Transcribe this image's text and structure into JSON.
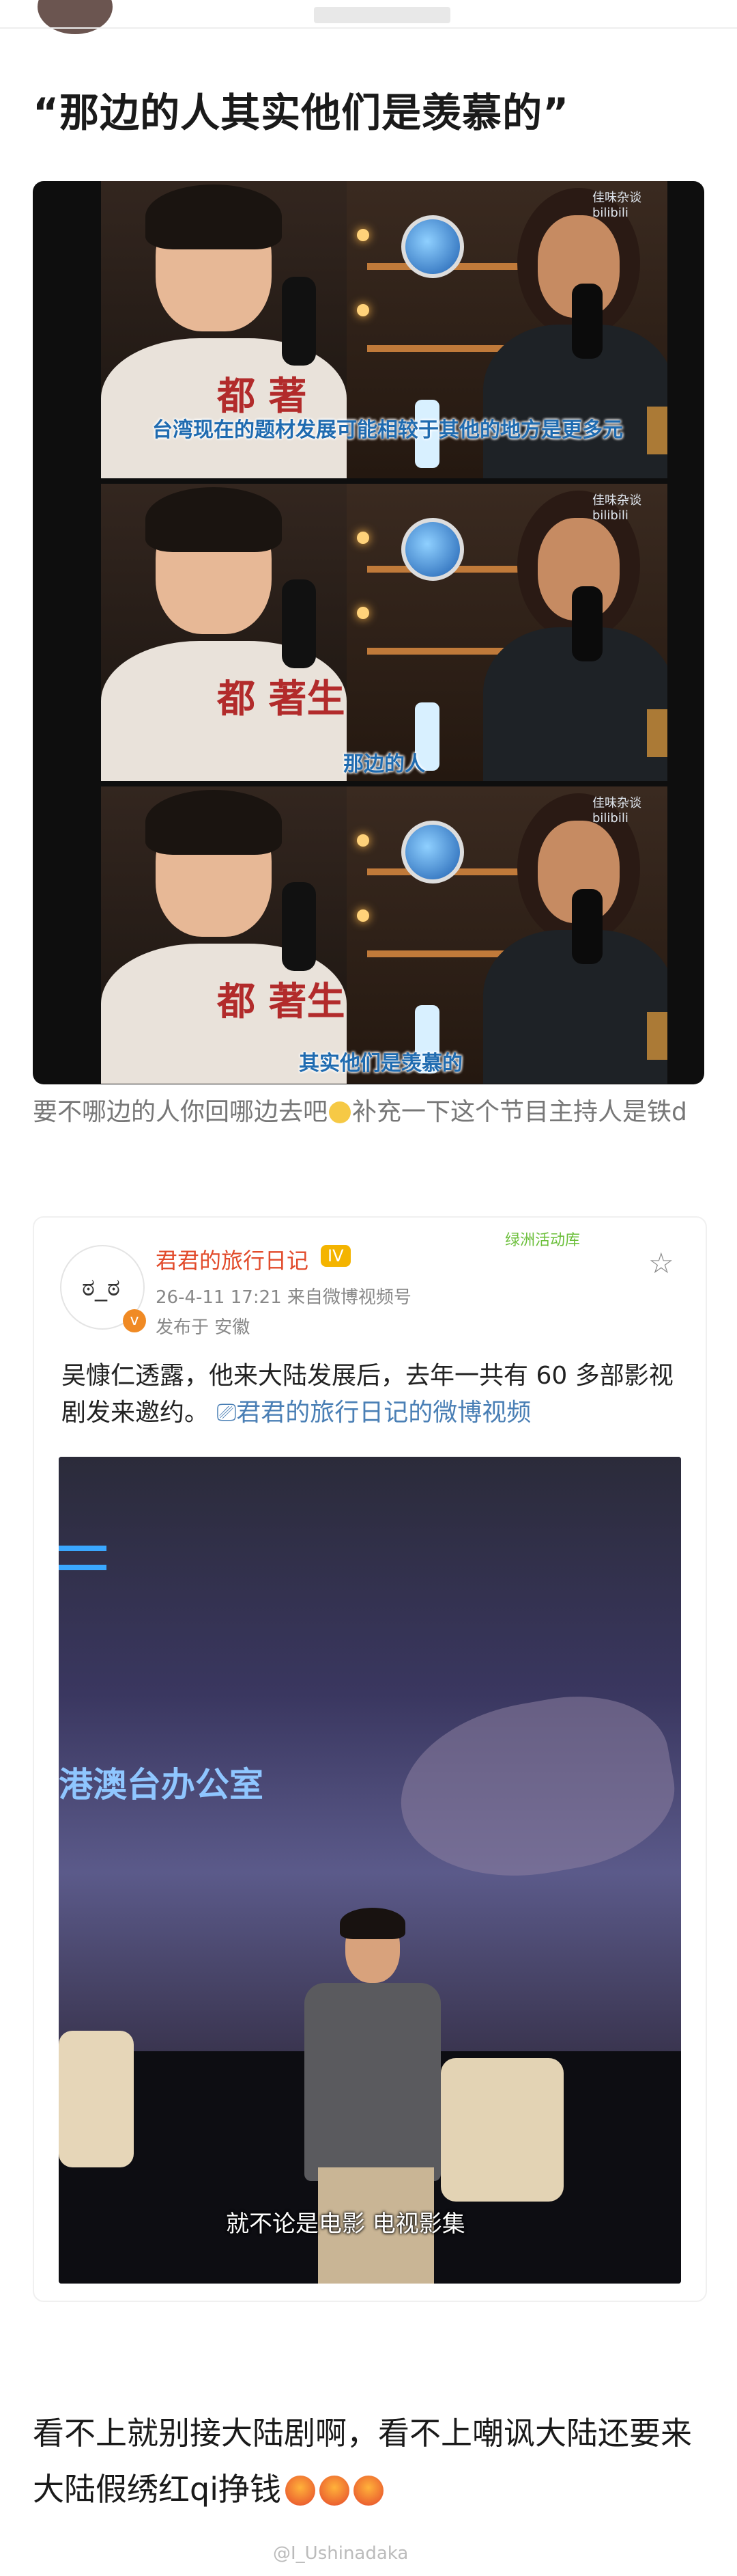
{
  "post_title": "“那边的人其实他们是羡慕的”",
  "video1": {
    "logo": "佳味杂谈 bilibili",
    "panels": [
      {
        "subtitle": "台湾现在的题材发展可能相较于其他的地方是更多元",
        "shirt_text": "都 著"
      },
      {
        "subtitle": "那边的人",
        "shirt_text": "都 著生"
      },
      {
        "subtitle": "其实他们是羡慕的",
        "shirt_text": "都 著生"
      }
    ]
  },
  "caption": {
    "before": "要不哪边的人你回哪边去吧",
    "emoji": "eye-roll-emoji",
    "after": "补充一下这个节目主持人是铁d"
  },
  "weibo": {
    "username": "君君的旅行日记",
    "vip": "IV",
    "time_source": "26-4-11 17:21  来自微博视频号",
    "location": "发布于 安徽",
    "sticker": "绿洲活动库",
    "post_text": "吴慷仁透露，他来大陆发展后，去年一共有 60 多部影视剧发来邀约。",
    "video_link": "君君的旅行日记的微博视频",
    "video2": {
      "banner": "港澳台办公室",
      "subtitle": "就不论是电影   电视影集"
    }
  },
  "comment": {
    "text": "看不上就别接大陆剧啊，看不上嘲讽大陆还要来大陆假绣红qi挣钱"
  },
  "watermark": "@I_Ushinadaka"
}
